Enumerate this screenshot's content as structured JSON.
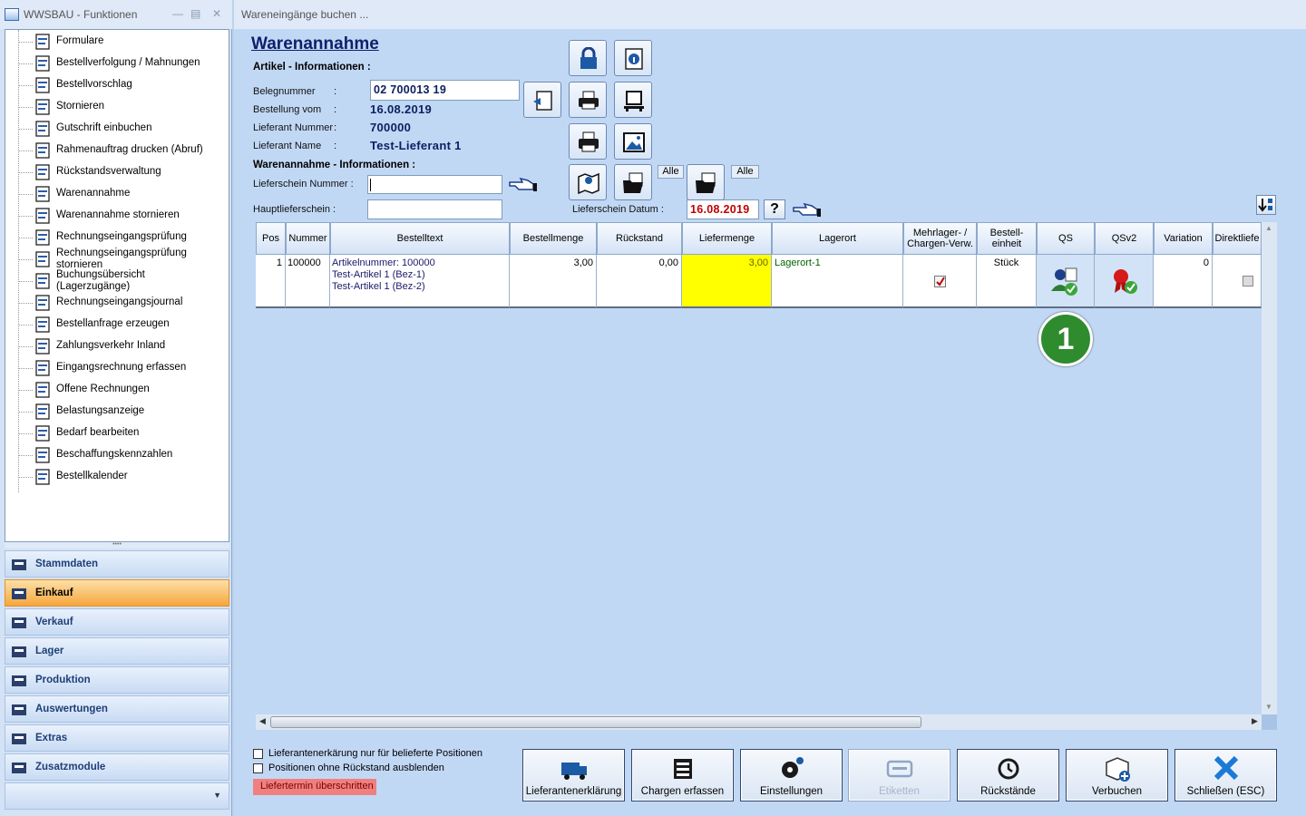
{
  "left_window": {
    "title": "WWSBAU - Funktionen",
    "tree_items": [
      {
        "label": "Formulare",
        "icon": "document-icon"
      },
      {
        "label": "Bestellverfolgung / Mahnungen",
        "icon": "map-icon"
      },
      {
        "label": "Bestellvorschlag",
        "icon": "cart-icon"
      },
      {
        "label": "Stornieren",
        "icon": "cart-cancel-icon"
      },
      {
        "label": "Gutschrift einbuchen",
        "icon": "credit-icon"
      },
      {
        "label": "Rahmenauftrag drucken (Abruf)",
        "icon": "print-document-icon"
      },
      {
        "label": "Rückstandsverwaltung",
        "icon": "history-icon"
      },
      {
        "label": "Warenannahme",
        "icon": "goods-receipt-icon"
      },
      {
        "label": "Warenannahme stornieren",
        "icon": "goods-receipt-cancel-icon"
      },
      {
        "label": "Rechnungseingangsprüfung",
        "icon": "invoice-check-icon"
      },
      {
        "label": "Rechnungseingangsprüfung\nstornieren",
        "icon": "invoice-check-cancel-icon"
      },
      {
        "label": "Buchungsübersicht\n(Lagerzugänge)",
        "icon": "list-icon"
      },
      {
        "label": "Rechnungseingangsjournal",
        "icon": "journal-icon"
      },
      {
        "label": "Bestellanfrage erzeugen",
        "icon": "request-icon"
      },
      {
        "label": "Zahlungsverkehr Inland",
        "icon": "payment-icon"
      },
      {
        "label": "Eingangsrechnung erfassen",
        "icon": "euro-icon"
      },
      {
        "label": "Offene Rechnungen",
        "icon": "euro-open-icon"
      },
      {
        "label": "Belastungsanzeige",
        "icon": "weight-icon"
      },
      {
        "label": "Bedarf bearbeiten",
        "icon": "calculator-icon"
      },
      {
        "label": "Beschaffungskennzahlen",
        "icon": "statistics-icon"
      },
      {
        "label": "Bestellkalender",
        "icon": "calendar-icon"
      }
    ],
    "nav": [
      {
        "label": "Stammdaten",
        "selected": false
      },
      {
        "label": "Einkauf",
        "selected": true
      },
      {
        "label": "Verkauf",
        "selected": false
      },
      {
        "label": "Lager",
        "selected": false
      },
      {
        "label": "Produktion",
        "selected": false
      },
      {
        "label": "Auswertungen",
        "selected": false
      },
      {
        "label": "Extras",
        "selected": false
      },
      {
        "label": "Zusatzmodule",
        "selected": false
      }
    ]
  },
  "right_window": {
    "title": "Wareneingänge buchen ...",
    "heading": "Warenannahme",
    "artikel_section": "Artikel - Informationen :",
    "belegnummer_label": "Belegnummer",
    "belegnummer_value": "02 700013 19",
    "bestellung_label": "Bestellung vom",
    "bestellung_value": "16.08.2019",
    "lieferant_nr_label": "Lieferant Nummer",
    "lieferant_nr_value": "700000",
    "lieferant_name_label": "Lieferant Name",
    "lieferant_name_value": "Test-Lieferant 1",
    "colon": ":",
    "warenannahme_section": "Warenannahme - Informationen :",
    "lieferschein_nr_label": "Lieferschein Nummer :",
    "lieferschein_nr_value": "",
    "hauptlieferschein_label": "Hauptlieferschein :",
    "hauptlieferschein_value": "",
    "lieferschein_datum_label": "Lieferschein Datum :",
    "lieferschein_datum_value": "16.08.2019",
    "question_label": "?",
    "alle1": "Alle",
    "alle2": "Alle",
    "table": {
      "headers": [
        "Pos",
        "Nummer",
        "Bestelltext",
        "Bestellmenge",
        "Rückstand",
        "Liefermenge",
        "Lagerort",
        "Mehrlager- /\nChargen-Verw.",
        "Bestell-\neinheit",
        "QS",
        "QSv2",
        "Variation",
        "Direktliefe"
      ],
      "rows": [
        {
          "pos": "1",
          "nummer": "100000",
          "bestelltext_1": "Artikelnummer: 100000",
          "bestelltext_2": "Test-Artikel 1  (Bez-1)",
          "bestelltext_3": "Test-Artikel 1  (Bez-2)",
          "bestellmenge": "3,00",
          "rueckstand": "0,00",
          "liefermenge": "3,00",
          "lagerort": "Lagerort-1",
          "mehrlager_checked": true,
          "einheit": "Stück",
          "variation": "0",
          "direktlieferung_checked": false
        }
      ]
    },
    "marker": "1",
    "checkbox_1": "Lieferantenerkärung nur für belieferte Positionen",
    "checkbox_2": "Positionen ohne Rückstand ausblenden",
    "warning": "Liefertermin überschritten",
    "buttons": [
      {
        "label": "Lieferantenerklärung",
        "icon": "truck-icon",
        "enabled": true
      },
      {
        "label": "Chargen erfassen",
        "icon": "batch-icon",
        "enabled": true
      },
      {
        "label": "Einstellungen",
        "icon": "gear-icon",
        "enabled": true
      },
      {
        "label": "Etiketten",
        "icon": "label-icon",
        "enabled": false
      },
      {
        "label": "Rückstände",
        "icon": "history-icon",
        "enabled": true
      },
      {
        "label": "Verbuchen",
        "icon": "book-in-icon",
        "enabled": true
      },
      {
        "label": "Schließen (ESC)",
        "icon": "close-icon",
        "enabled": true
      }
    ]
  },
  "colors": {
    "accent": "#10206a",
    "selected_nav": "#f6a63e",
    "highlight_cell": "#ffff00",
    "date_red": "#c00000",
    "warning_bg": "#f08080",
    "marker_green": "#2e8b2e"
  }
}
